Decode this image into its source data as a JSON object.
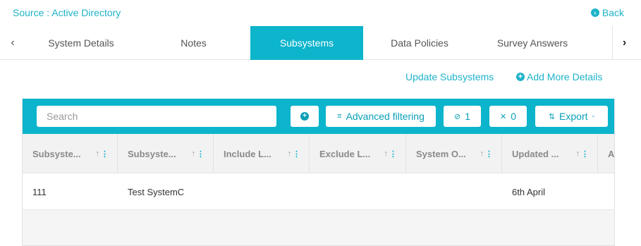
{
  "header": {
    "source": "Source : Active Directory",
    "back_label": "Back"
  },
  "tabs": [
    {
      "label": "System Details",
      "active": false
    },
    {
      "label": "Notes",
      "active": false
    },
    {
      "label": "Subsystems",
      "active": true
    },
    {
      "label": "Data Policies",
      "active": false
    },
    {
      "label": "Survey Answers",
      "active": false
    }
  ],
  "actions": {
    "update": "Update Subsystems",
    "add_more": "Add More Details"
  },
  "toolbar": {
    "search_placeholder": "Search",
    "advanced_filtering": "Advanced filtering",
    "hidden_count": "1",
    "pinned_count": "0",
    "export": "Export"
  },
  "table": {
    "columns": [
      "Subsyste...",
      "Subsyste...",
      "Include L...",
      "Exclude L...",
      "System O...",
      "Updated ...",
      "Ac"
    ],
    "rows": [
      [
        "111",
        "Test SystemC",
        "",
        "",
        "",
        "6th April",
        ""
      ]
    ]
  },
  "colors": {
    "accent": "#0cb4cc",
    "link": "#1fb3c8"
  }
}
